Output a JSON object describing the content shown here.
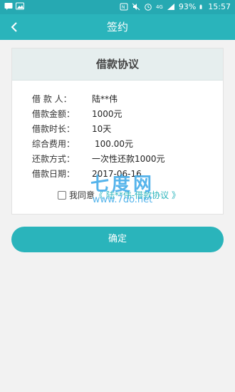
{
  "status_bar": {
    "battery": "93%",
    "time": "15:57",
    "network": "4G"
  },
  "header": {
    "title": "签约",
    "back_icon": "chevron-left-icon"
  },
  "agreement": {
    "title": "借款协议",
    "rows": [
      {
        "label": "借 款 人：",
        "value": "陆**伟"
      },
      {
        "label": "借款金额：",
        "value": "1000元"
      },
      {
        "label": "借款时长：",
        "value": "10天"
      },
      {
        "label": "综合费用：",
        "value": "100.00元"
      },
      {
        "label": "还款方式：",
        "value": "一次性还款1000元"
      },
      {
        "label": "借款日期：",
        "value": "2017-06-16"
      }
    ],
    "agree_prefix": "我同意",
    "agree_link": "《 陆**伟-借款协议 》",
    "checked": false
  },
  "watermark": {
    "brand": "七度网",
    "url": "www.7do.net"
  },
  "actions": {
    "confirm_label": "确定"
  },
  "colors": {
    "accent": "#2ab4bb",
    "status_bar": "#26a9b2",
    "watermark": "#39a8e8"
  }
}
